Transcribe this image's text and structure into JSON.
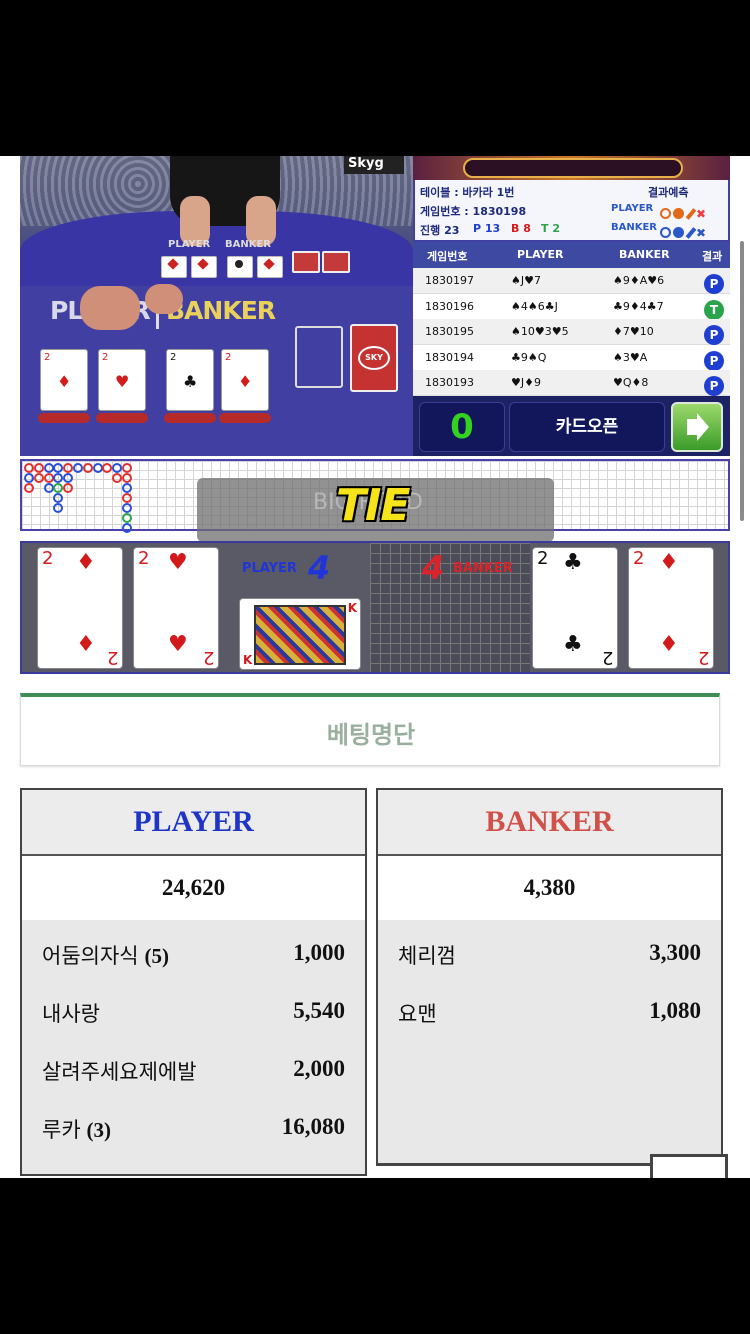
{
  "stream": {
    "logo": "Skyg",
    "player_label": "PLAYER",
    "banker_label": "BANKER",
    "zoom_player": "PLAYER",
    "zoom_banker": "BANKER",
    "deck_mark": "SKY"
  },
  "info": {
    "table_label": "테이블 : 바카라 1번",
    "game_no_label": "게임번호 : 1830198",
    "progress_label": "진행 23",
    "p_count": "P 13",
    "b_count": "B 8",
    "t_count": "T 2",
    "predict_title": "결과예측",
    "predict_player": "PLAYER",
    "predict_banker": "BANKER"
  },
  "history": {
    "headers": [
      "게임번호",
      "PLAYER",
      "BANKER",
      "결과"
    ],
    "rows": [
      {
        "no": "1830197",
        "player": "♠J♥7",
        "banker": "♠9♦A♥6",
        "result": "P",
        "color": "#1f3fd0"
      },
      {
        "no": "1830196",
        "player": "♠4♠6♣J",
        "banker": "♣9♦4♣7",
        "result": "T",
        "color": "#2aa44a"
      },
      {
        "no": "1830195",
        "player": "♠10♥3♥5",
        "banker": "♦7♥10",
        "result": "P",
        "color": "#1f3fd0"
      },
      {
        "no": "1830194",
        "player": "♣9♠Q",
        "banker": "♠3♥A",
        "result": "P",
        "color": "#1f3fd0"
      },
      {
        "no": "1830193",
        "player": "♥J♦9",
        "banker": "♥Q♦8",
        "result": "P",
        "color": "#1f3fd0"
      }
    ]
  },
  "controls": {
    "timer": "0",
    "card_open_label": "카드오픈"
  },
  "roadmap": {
    "ghost_text": "BIG ROAD"
  },
  "result_banner": {
    "text": "TIE"
  },
  "round": {
    "player_label": "PLAYER",
    "player_score": "4",
    "banker_label": "BANKER",
    "banker_score": "4",
    "player_cards": [
      {
        "rank": "2",
        "suit": "♦",
        "color": "red"
      },
      {
        "rank": "2",
        "suit": "♥",
        "color": "red"
      }
    ],
    "player_third_card": "K",
    "banker_cards": [
      {
        "rank": "2",
        "suit": "♣",
        "color": "black"
      },
      {
        "rank": "2",
        "suit": "♦",
        "color": "red"
      }
    ]
  },
  "bet_list": {
    "title": "베팅명단"
  },
  "player_box": {
    "title": "PLAYER",
    "title_color": "#1f35c8",
    "total": "24,620",
    "rows": [
      {
        "name": "어둠의자식",
        "count": "(5)",
        "amount": "1,000"
      },
      {
        "name": "내사랑",
        "count": "",
        "amount": "5,540"
      },
      {
        "name": "살려주세요제에발",
        "count": "",
        "amount": "2,000"
      },
      {
        "name": "루카",
        "count": "(3)",
        "amount": "16,080"
      }
    ]
  },
  "banker_box": {
    "title": "BANKER",
    "title_color": "#d0504a",
    "total": "4,380",
    "rows": [
      {
        "name": "체리껌",
        "amount": "3,300"
      },
      {
        "name": "요맨",
        "amount": "1,080"
      }
    ]
  }
}
